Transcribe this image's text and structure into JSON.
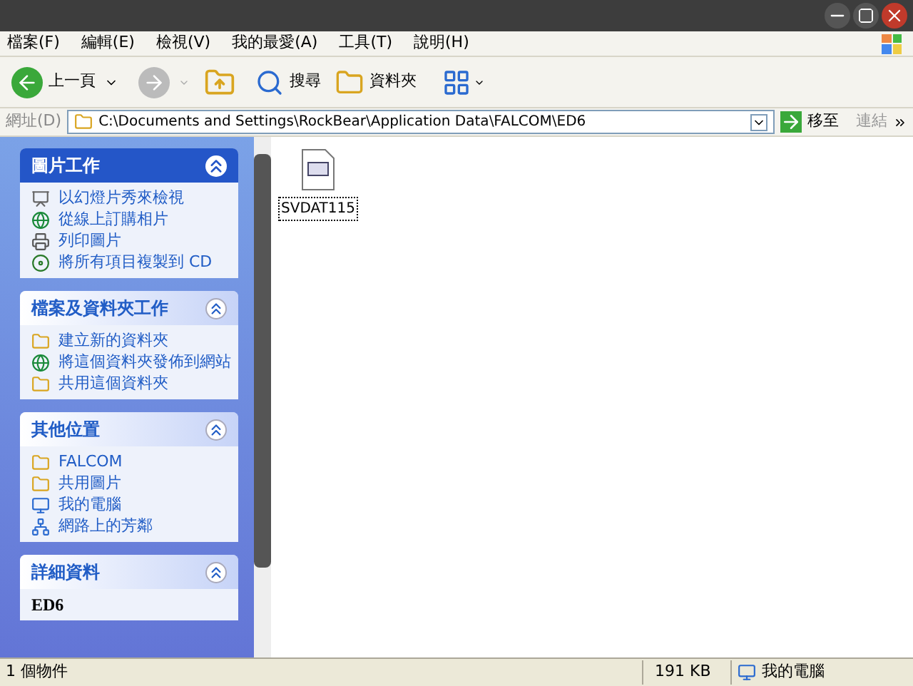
{
  "menu": [
    "檔案(F)",
    "編輯(E)",
    "檢視(V)",
    "我的最愛(A)",
    "工具(T)",
    "說明(H)"
  ],
  "toolbar": {
    "back": "上一頁",
    "search": "搜尋",
    "folders": "資料夾"
  },
  "address": {
    "label": "網址(D)",
    "value": "C:\\Documents and Settings\\RockBear\\Application Data\\FALCOM\\ED6",
    "go": "移至",
    "links": "連結"
  },
  "sidebar": [
    {
      "kind": "primary",
      "title": "圖片工作",
      "items": [
        {
          "kind": "slideshow",
          "label": "以幻燈片秀來檢視"
        },
        {
          "kind": "globe",
          "label": "從線上訂購相片"
        },
        {
          "kind": "printer",
          "label": "列印圖片"
        },
        {
          "kind": "disc",
          "label": "將所有項目複製到 CD"
        }
      ]
    },
    {
      "kind": "normal",
      "title": "檔案及資料夾工作",
      "items": [
        {
          "kind": "folder",
          "label": "建立新的資料夾"
        },
        {
          "kind": "globe",
          "label": "將這個資料夾發佈到網站"
        },
        {
          "kind": "folder",
          "label": "共用這個資料夾"
        }
      ]
    },
    {
      "kind": "normal",
      "title": "其他位置",
      "items": [
        {
          "kind": "folder",
          "label": "FALCOM"
        },
        {
          "kind": "folder",
          "label": "共用圖片"
        },
        {
          "kind": "computer",
          "label": "我的電腦"
        },
        {
          "kind": "network",
          "label": "網路上的芳鄰"
        }
      ]
    },
    {
      "kind": "normal",
      "title": "詳細資料",
      "items": [
        {
          "kind": "detail",
          "label": "ED6"
        }
      ]
    }
  ],
  "files": [
    {
      "name": "SVDAT115",
      "selected": true
    }
  ],
  "status_bar": {
    "count": "1 個物件",
    "size": "191 KB",
    "location": "我的電腦"
  }
}
